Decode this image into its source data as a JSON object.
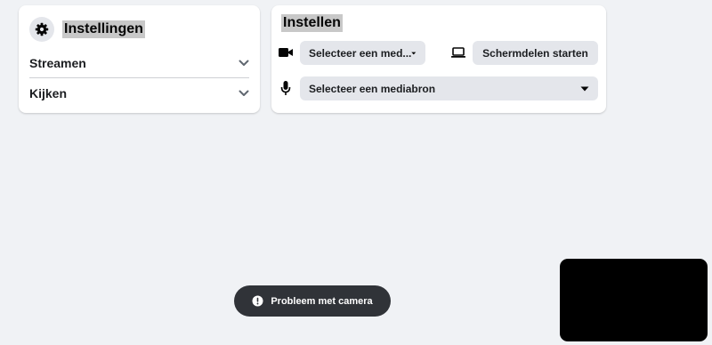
{
  "settings": {
    "title": "Instellingen",
    "icon": "gear-icon",
    "items": [
      {
        "label": "Streamen",
        "icon": "chevron-down-icon"
      },
      {
        "label": "Kijken",
        "icon": "chevron-down-icon"
      }
    ]
  },
  "setup": {
    "title": "Instellen",
    "video_source": {
      "value": "Selecteer een med...",
      "icon": "video-camera-icon"
    },
    "screen_share": {
      "label": "Schermdelen starten",
      "icon": "laptop-icon"
    },
    "audio_source": {
      "value": "Selecteer een mediabron",
      "icon": "microphone-icon"
    }
  },
  "toast": {
    "message": "Probleem met camera",
    "icon": "alert-icon"
  },
  "colors": {
    "background": "#f0f2f5",
    "card": "#ffffff",
    "pill": "#e4e6eb",
    "toast": "#303338",
    "highlight": "#c8c8c8"
  }
}
